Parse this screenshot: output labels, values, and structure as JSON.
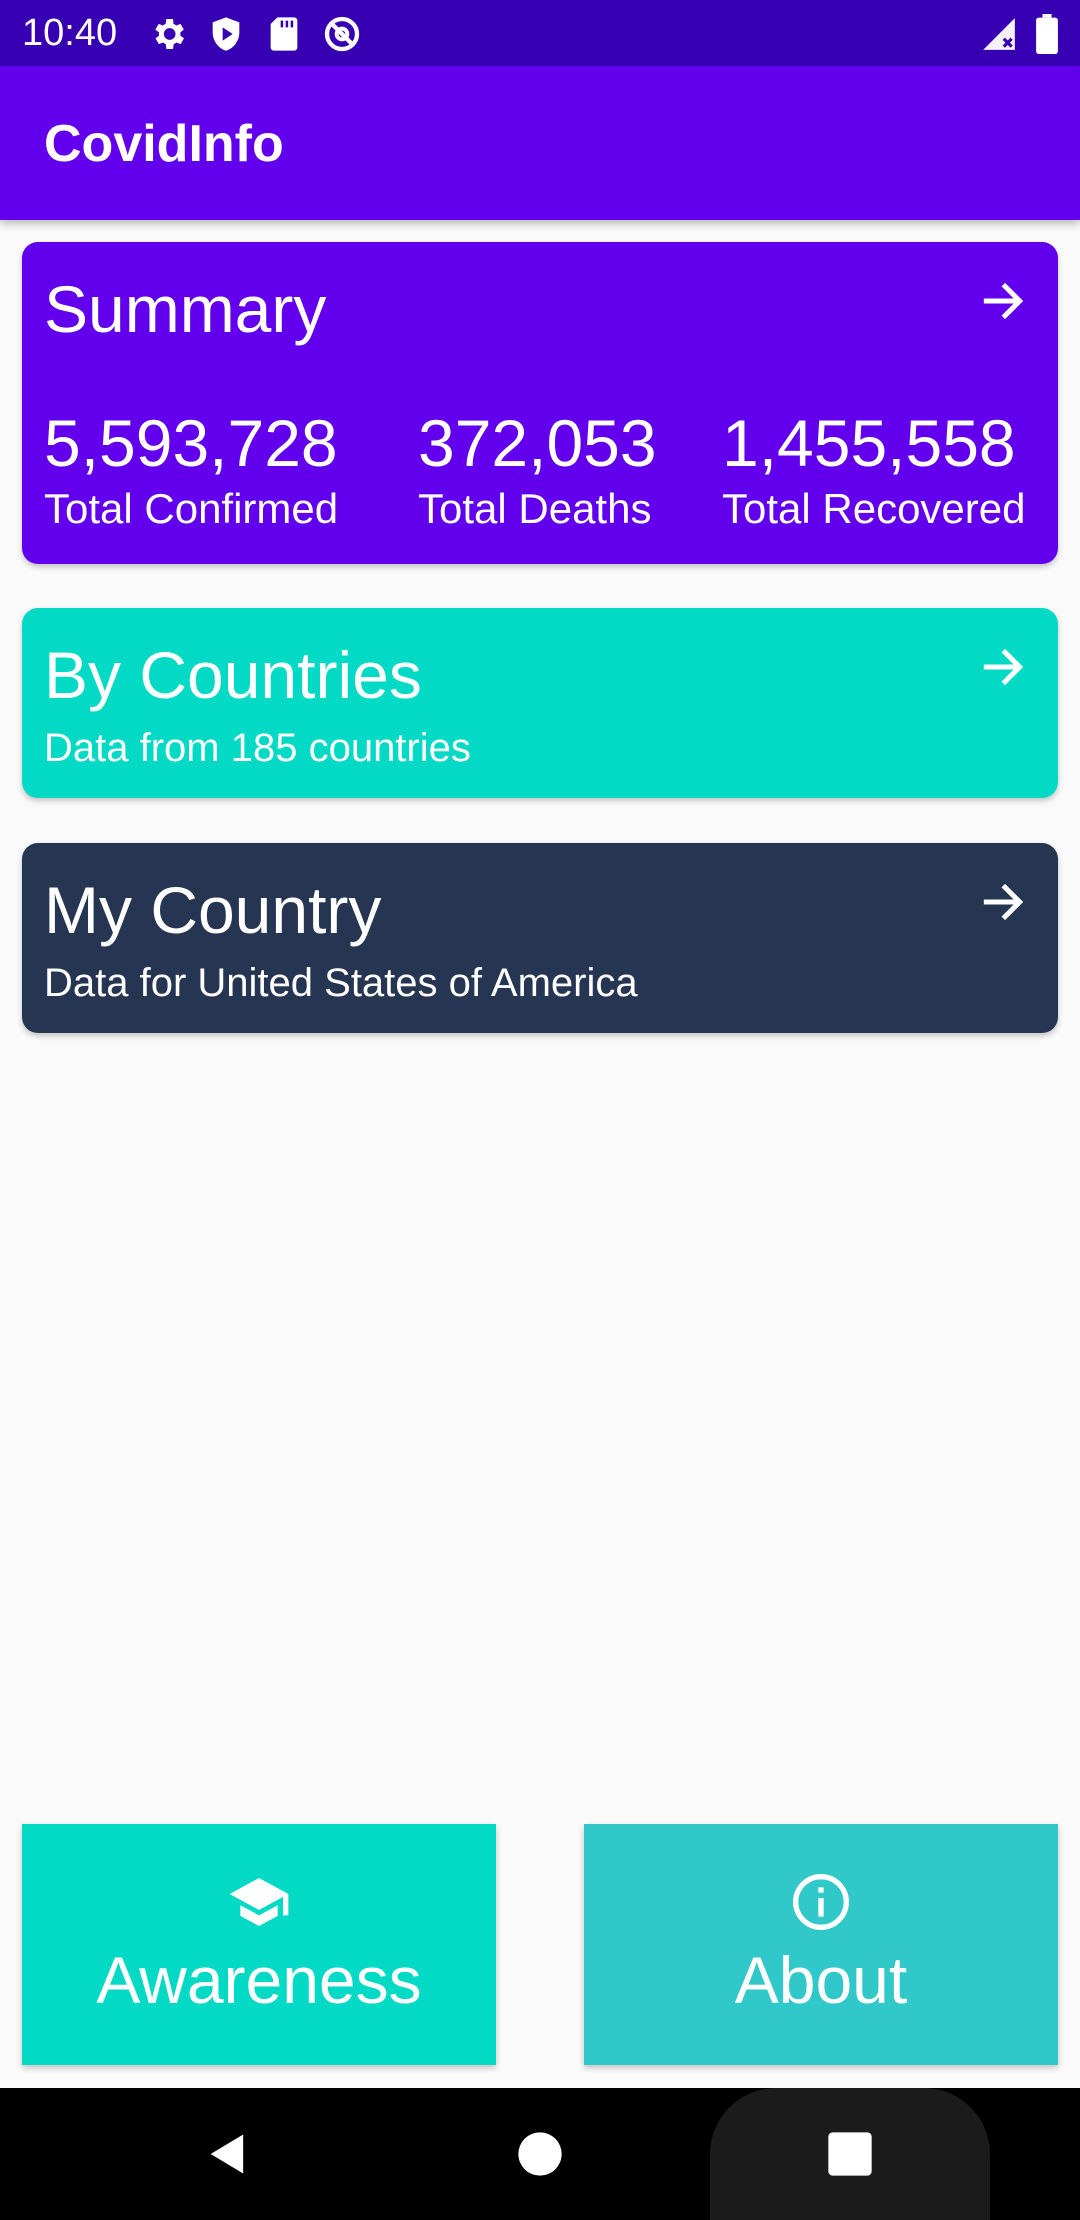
{
  "status_bar": {
    "time": "10:40",
    "icons_left": [
      "gear-icon",
      "shield-icon",
      "sd-card-icon",
      "at-sign-icon"
    ],
    "icons_right": [
      "signal-icon",
      "battery-icon"
    ]
  },
  "app_bar": {
    "title": "CovidInfo"
  },
  "summary": {
    "title": "Summary",
    "stats": [
      {
        "value": "5,593,728",
        "label": "Total Confirmed"
      },
      {
        "value": "372,053",
        "label": "Total Deaths"
      },
      {
        "value": "1,455,558",
        "label": "Total Recovered"
      }
    ],
    "color": "#6200ee"
  },
  "by_countries": {
    "title": "By Countries",
    "subtitle": "Data from 185 countries",
    "color": "#03dac5"
  },
  "my_country": {
    "title": "My Country",
    "subtitle": "Data for United States of America",
    "color": "#263552"
  },
  "bottom_buttons": [
    {
      "label": "Awareness",
      "icon": "graduation-cap-icon",
      "color": "#03dac5"
    },
    {
      "label": "About",
      "icon": "info-icon",
      "color": "#30c8c8"
    }
  ],
  "nav_bar": {
    "buttons": [
      "back-icon",
      "home-icon",
      "recents-icon"
    ]
  }
}
